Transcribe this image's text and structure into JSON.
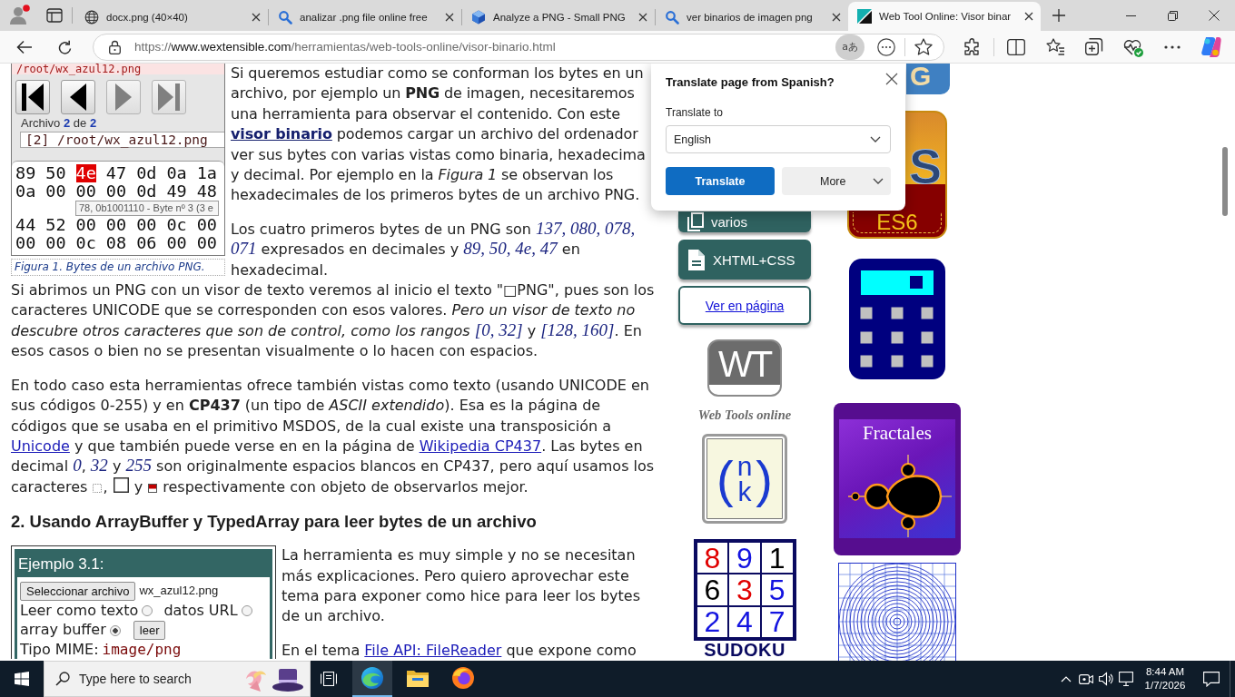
{
  "browser": {
    "tabs": [
      {
        "title": "docx.png (40×40)",
        "kind": "globe",
        "selected": false
      },
      {
        "title": "analizar .png file online free",
        "kind": "search",
        "selected": false
      },
      {
        "title": "Analyze a PNG - Small PNG",
        "kind": "cube",
        "selected": false
      },
      {
        "title": "ver binarios de imagen png",
        "kind": "search",
        "selected": false
      },
      {
        "title": "Web Tool Online: Visor binar",
        "kind": "site",
        "selected": true
      }
    ],
    "address": {
      "scheme": "https://",
      "host": "www.wextensible.com",
      "path": "/herramientas/web-tools-online/visor-binario.html"
    },
    "translate_glyph": "aあ",
    "translate_active": true
  },
  "translate_popup": {
    "title": "Translate page from Spanish?",
    "label": "Translate to",
    "language": "English",
    "primary": "Translate",
    "secondary": "More"
  },
  "article": {
    "figure": {
      "path_top": "/root/wx_azul12.png",
      "nav": [
        {
          "kind": "first",
          "disabled": false
        },
        {
          "kind": "prev",
          "disabled": false
        },
        {
          "kind": "next",
          "disabled": true
        },
        {
          "kind": "last",
          "disabled": true
        }
      ],
      "counter": "Archivo **2** de **2**",
      "file_path": "[2] /root/wx_azul12.png",
      "hex_rows": [
        [
          {
            "text": "89",
            "selected": false
          },
          {
            "text": "50",
            "selected": false
          },
          {
            "text": "4e",
            "selected": true
          },
          {
            "text": "47",
            "selected": false
          },
          {
            "text": "0d",
            "selected": false
          },
          {
            "text": "0a",
            "selected": false
          },
          {
            "text": "1a",
            "selected": false
          }
        ],
        [
          {
            "text": "0a",
            "selected": false
          },
          {
            "text": "00",
            "selected": false
          },
          {
            "text": "00",
            "selected": false
          },
          {
            "text": "00",
            "selected": false
          },
          {
            "text": "0d",
            "selected": false
          },
          {
            "text": "49",
            "selected": false
          },
          {
            "text": "48",
            "selected": false
          }
        ],
        [
          {
            "text": "44",
            "selected": false
          },
          {
            "text": "52",
            "selected": false
          },
          {
            "text": "00",
            "selected": false
          },
          {
            "text": "00",
            "selected": false
          },
          {
            "text": "00",
            "selected": false
          },
          {
            "text": "0c",
            "selected": false
          },
          {
            "text": "00",
            "selected": false
          }
        ],
        [
          {
            "text": "00",
            "selected": false
          },
          {
            "text": "00",
            "selected": false
          },
          {
            "text": "0c",
            "selected": false
          },
          {
            "text": "08",
            "selected": false
          },
          {
            "text": "06",
            "selected": false
          },
          {
            "text": "00",
            "selected": false
          },
          {
            "text": "00",
            "selected": false
          }
        ]
      ],
      "tooltip": "78, 0b1001110 - Byte nº 3 (3 e",
      "caption": "Figura 1. Bytes de un archivo PNG."
    },
    "intro": [
      [
        {
          "kind": "text",
          "text": "Si queremos estudiar como se conforman los bytes en un archivo, por ejemplo un **PNG** de imagen, necesitaremos una herramienta para observar el contenido. Con este "
        },
        {
          "kind": "link",
          "text": "visor binario",
          "bold": true
        },
        {
          "kind": "text",
          "text": " podemos cargar un archivo del ordenador ver sus bytes con varias vistas como binaria, hexadecima y decimal. Por ejemplo en la *Figura 1* se observan los hexadecimales de los primeros bytes de un archivo PNG."
        }
      ],
      [
        {
          "kind": "text",
          "text": "Los cuatro primeros bytes de un PNG son "
        },
        {
          "kind": "math",
          "text": "137, 080, 078, 071"
        },
        {
          "kind": "text",
          "text": " expresados en decimales y "
        },
        {
          "kind": "math",
          "text": "89, 50, 4e, 47"
        },
        {
          "kind": "text",
          "text": " en hexadecimal."
        }
      ],
      [
        {
          "kind": "text",
          "text": "Si abrimos un PNG con un visor de texto veremos al inicio el texto \"□PNG\", pues son los caracteres UNICODE que se corresponden con esos valores. *Pero un visor de texto no descubre otros caracteres que son de control, como los rangos* "
        },
        {
          "kind": "math",
          "text": "[0, 32]"
        },
        {
          "kind": "text",
          "text": " y "
        },
        {
          "kind": "math",
          "text": "[128, 160]"
        },
        {
          "kind": "text",
          "text": ". En esos casos o bien no se presentan visualmente o lo hacen con espacios."
        }
      ],
      [
        {
          "kind": "text",
          "text": "En todo caso esta herramientas ofrece también vistas como texto (usando UNICODE en sus códigos 0-255) y en **CP437** (un tipo de *ASCII extendido*). Esa es la página de códigos que se usaba en el primitivo MSDOS, de la cual existe una transposición a "
        },
        {
          "kind": "link",
          "text": "Unicode",
          "bold": false
        },
        {
          "kind": "text",
          "text": " y que también puede verse en en la página de "
        },
        {
          "kind": "link",
          "text": "Wikipedia CP437",
          "bold": false
        },
        {
          "kind": "text",
          "text": ". Las bytes en decimal "
        },
        {
          "kind": "math",
          "text": "0"
        },
        {
          "kind": "text",
          "text": ", "
        },
        {
          "kind": "math",
          "text": "32"
        },
        {
          "kind": "text",
          "text": " y "
        },
        {
          "kind": "math",
          "text": "255"
        },
        {
          "kind": "text",
          "text": " son originalmente espacios blancos en CP437, pero aquí usamos los caracteres "
        },
        {
          "kind": "glyph"
        },
        {
          "kind": "text",
          "text": ", "
        },
        {
          "kind": "glyph"
        },
        {
          "kind": "text",
          "text": " y "
        },
        {
          "kind": "glyph"
        },
        {
          "kind": "text",
          "text": " respectivamente con objeto de observarlos mejor."
        }
      ]
    ],
    "heading": "2. Usando ArrayBuffer y TypedArray para leer bytes de un archivo",
    "example": {
      "title": "Ejemplo 3.1:",
      "file_button": "Seleccionar archivo",
      "file_name": "wx_azul12.png",
      "options": [
        {
          "label": "Leer como texto",
          "selected": false
        },
        {
          "label": "datos URL",
          "selected": false
        },
        {
          "label": "array buffer",
          "selected": true
        }
      ],
      "read_button": "leer",
      "mime_label": "Tipo MIME:",
      "mime_value": "image/png"
    },
    "section": [
      [
        {
          "kind": "text",
          "text": "La herramienta es muy simple y no se necesitan más explicaciones. Pero quiero aprovechar este tema para exponer como hice para leer los bytes de un archivo."
        }
      ],
      [
        {
          "kind": "text",
          "text": "En el tema "
        },
        {
          "kind": "link",
          "text": "File API: FileReader",
          "bold": false
        },
        {
          "kind": "text",
          "text": " que expone como"
        }
      ]
    ]
  },
  "sidebar": {
    "menu_buttons": [
      {
        "label": "varios",
        "kind": "outline"
      },
      {
        "label": "XHTML+CSS",
        "kind": "document"
      }
    ],
    "page_link": "Ver en página",
    "wt_logo": "WT",
    "wt_caption": "Web Tools online",
    "binomial": {
      "open": "(",
      "top": "n",
      "bottom": "k",
      "close": ")"
    },
    "sudoku": {
      "cells": [
        [
          {
            "digit": "8",
            "color": "#e00000"
          },
          {
            "digit": "9",
            "color": "#1414e0"
          },
          {
            "digit": "1",
            "color": "#000000"
          }
        ],
        [
          {
            "digit": "6",
            "color": "#000000"
          },
          {
            "digit": "3",
            "color": "#e00000"
          },
          {
            "digit": "5",
            "color": "#1414e0"
          }
        ],
        [
          {
            "digit": "2",
            "color": "#1414e0"
          },
          {
            "digit": "4",
            "color": "#1414e0"
          },
          {
            "digit": "7",
            "color": "#1414e0"
          }
        ]
      ],
      "title": "SUDOKU"
    },
    "g_logo": "G",
    "es6": {
      "letter": "S",
      "band": "ES6"
    },
    "fractal_title": "Fractales"
  },
  "taskbar": {
    "search_placeholder": "Type here to search",
    "apps": [
      {
        "kind": "edge",
        "selected": true
      },
      {
        "kind": "explorer",
        "selected": false
      },
      {
        "kind": "firefox",
        "selected": false
      }
    ],
    "time": "8:44 AM",
    "date": "1/7/2026"
  }
}
